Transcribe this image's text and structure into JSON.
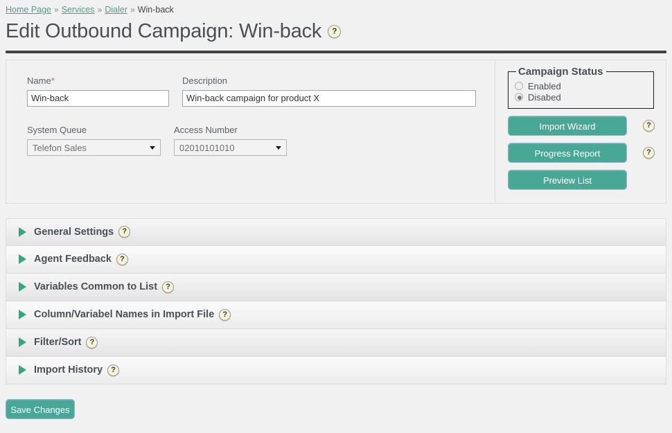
{
  "breadcrumb": {
    "separator": "»",
    "items": [
      {
        "label": "Home Page",
        "link": true
      },
      {
        "label": "Services",
        "link": true
      },
      {
        "label": "Dialer",
        "link": true
      },
      {
        "label": "Win-back",
        "link": false
      }
    ]
  },
  "header": {
    "title": "Edit Outbound Campaign: Win-back",
    "help_icon": "?"
  },
  "form": {
    "name": {
      "label": "Name",
      "required_marker": "*",
      "value": "Win-back",
      "placeholder": ""
    },
    "description": {
      "label": "Description",
      "value": "Win-back campaign for product X",
      "placeholder": ""
    },
    "system_queue": {
      "label": "System Queue",
      "value": "Telefon Sales",
      "options": [
        "Telefon Sales"
      ]
    },
    "access_number": {
      "label": "Access Number",
      "value": "02010101010",
      "options": [
        "02010101010"
      ]
    }
  },
  "campaign_status": {
    "legend": "Campaign Status",
    "options": [
      {
        "label": "Enabled",
        "selected": false
      },
      {
        "label": "Disabed",
        "selected": true
      }
    ]
  },
  "side_buttons": [
    {
      "label": "Import Wizard",
      "help": "?"
    },
    {
      "label": "Progress Report",
      "help": "?"
    },
    {
      "label": "Preview List",
      "help": null
    }
  ],
  "accordion": [
    {
      "label": "General Settings",
      "help": "?",
      "expanded": false
    },
    {
      "label": "Agent Feedback",
      "help": "?",
      "expanded": false
    },
    {
      "label": "Variables Common to List",
      "help": "?",
      "expanded": false
    },
    {
      "label": "Column/Variabel Names in Import File",
      "help": "?",
      "expanded": false
    },
    {
      "label": "Filter/Sort",
      "help": "?",
      "expanded": false
    },
    {
      "label": "Import History",
      "help": "?",
      "expanded": false
    }
  ],
  "footer": {
    "save_label": "Save Changes"
  },
  "colors": {
    "accent_teal": "#48a795",
    "triangle_green": "#33a683",
    "link_teal": "#4d9e8e",
    "required_red": "#e05a4f",
    "page_bg": "#f1f1f1",
    "title_gray": "#4a4f55",
    "help_bg": "#f7f2d8"
  }
}
